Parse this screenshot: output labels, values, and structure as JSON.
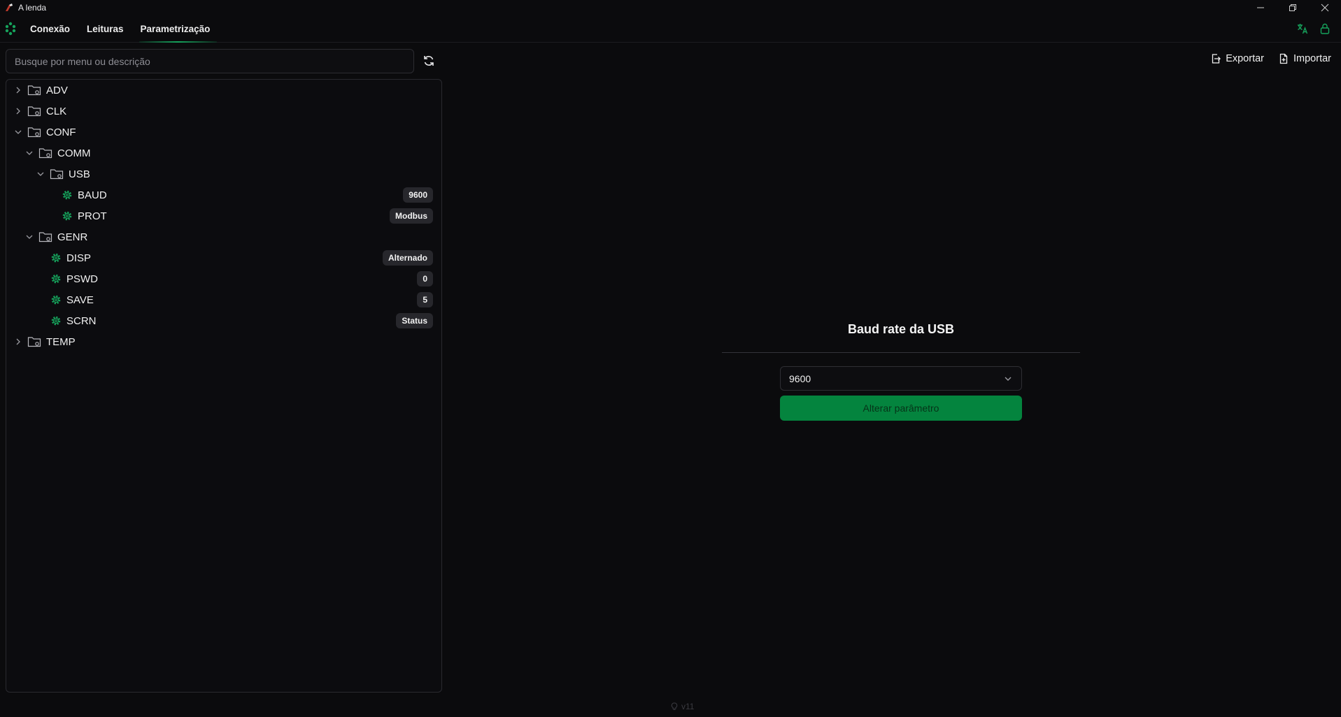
{
  "window": {
    "title": "A lenda"
  },
  "nav": {
    "tabs": [
      {
        "label": "Conexão",
        "active": false
      },
      {
        "label": "Leituras",
        "active": false
      },
      {
        "label": "Parametrização",
        "active": true
      }
    ]
  },
  "search": {
    "placeholder": "Busque por menu ou descrição",
    "value": ""
  },
  "toolbar": {
    "export_label": "Exportar",
    "import_label": "Importar"
  },
  "tree": {
    "items": [
      {
        "label": "ADV",
        "type": "folder",
        "level": 0,
        "expanded": false
      },
      {
        "label": "CLK",
        "type": "folder",
        "level": 0,
        "expanded": false
      },
      {
        "label": "CONF",
        "type": "folder",
        "level": 0,
        "expanded": true
      },
      {
        "label": "COMM",
        "type": "folder",
        "level": 1,
        "expanded": true
      },
      {
        "label": "USB",
        "type": "folder",
        "level": 2,
        "expanded": true
      },
      {
        "label": "BAUD",
        "type": "param",
        "level": 3,
        "value": "9600"
      },
      {
        "label": "PROT",
        "type": "param",
        "level": 3,
        "value": "Modbus"
      },
      {
        "label": "GENR",
        "type": "folder",
        "level": 1,
        "expanded": true
      },
      {
        "label": "DISP",
        "type": "param",
        "level": 2,
        "value": "Alternado"
      },
      {
        "label": "PSWD",
        "type": "param",
        "level": 2,
        "value": "0"
      },
      {
        "label": "SAVE",
        "type": "param",
        "level": 2,
        "value": "5"
      },
      {
        "label": "SCRN",
        "type": "param",
        "level": 2,
        "value": "Status"
      },
      {
        "label": "TEMP",
        "type": "folder",
        "level": 0,
        "expanded": false
      }
    ]
  },
  "detail": {
    "title": "Baud rate da USB",
    "selected_value": "9600",
    "apply_label": "Alterar parâmetro"
  },
  "footer": {
    "version": "v11"
  },
  "colors": {
    "accent": "#16a35c",
    "button": "#04843e",
    "background": "#0b0b0d"
  }
}
